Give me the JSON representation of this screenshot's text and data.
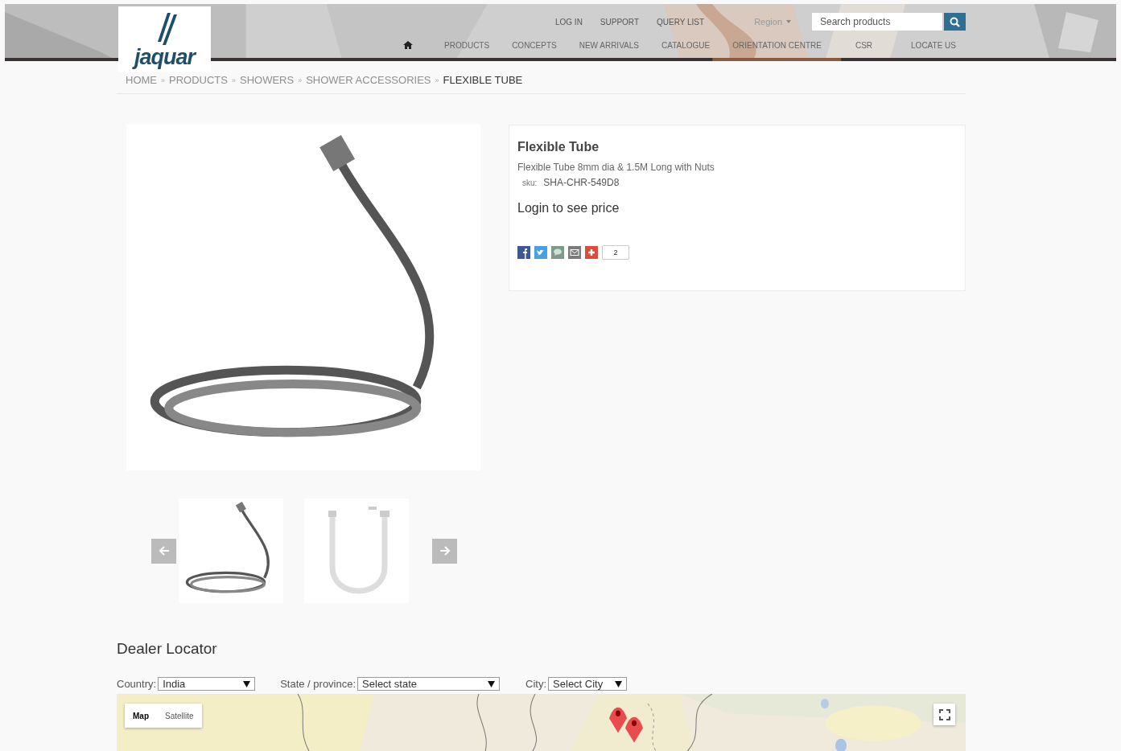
{
  "header": {
    "logo": "jaquar",
    "top_links": [
      {
        "label": "LOG IN"
      },
      {
        "label": "SUPPORT"
      },
      {
        "label": "QUERY LIST"
      }
    ],
    "region": "Region",
    "search": {
      "placeholder": "Search products"
    },
    "nav": [
      {
        "label": "PRODUCTS"
      },
      {
        "label": "CONCEPTS"
      },
      {
        "label": "NEW ARRIVALS"
      },
      {
        "label": "CATALOGUE"
      },
      {
        "label": "ORIENTATION CENTRE"
      },
      {
        "label": "CSR"
      },
      {
        "label": "LOCATE US"
      }
    ]
  },
  "breadcrumb": [
    {
      "label": "HOME",
      "separator": "»",
      "current": false
    },
    {
      "label": "PRODUCTS",
      "separator": "»",
      "current": false
    },
    {
      "label": "SHOWERS",
      "separator": "»",
      "current": false
    },
    {
      "label": "SHOWER ACCESSORIES",
      "separator": "»",
      "current": false
    },
    {
      "label": "FLEXIBLE TUBE",
      "current": true
    }
  ],
  "product": {
    "title": "Flexible Tube",
    "description": "Flexible Tube 8mm dia & 1.5M Long with Nuts",
    "sku_label": "sku:",
    "sku": "SHA-CHR-549D8",
    "price_note": "Login to see price",
    "share_count": "2"
  },
  "dealer_locator": {
    "title": "Dealer Locator",
    "filters": [
      {
        "label": "Country:",
        "value": "India",
        "kind": "wide"
      },
      {
        "label": "State / province:",
        "value": "Select state",
        "kind": "wider"
      },
      {
        "label": "City:",
        "value": "Select City",
        "kind": "narrow"
      }
    ],
    "map_types": [
      {
        "label": "Map",
        "selected": true
      },
      {
        "label": "Satellite",
        "selected": false
      }
    ]
  }
}
